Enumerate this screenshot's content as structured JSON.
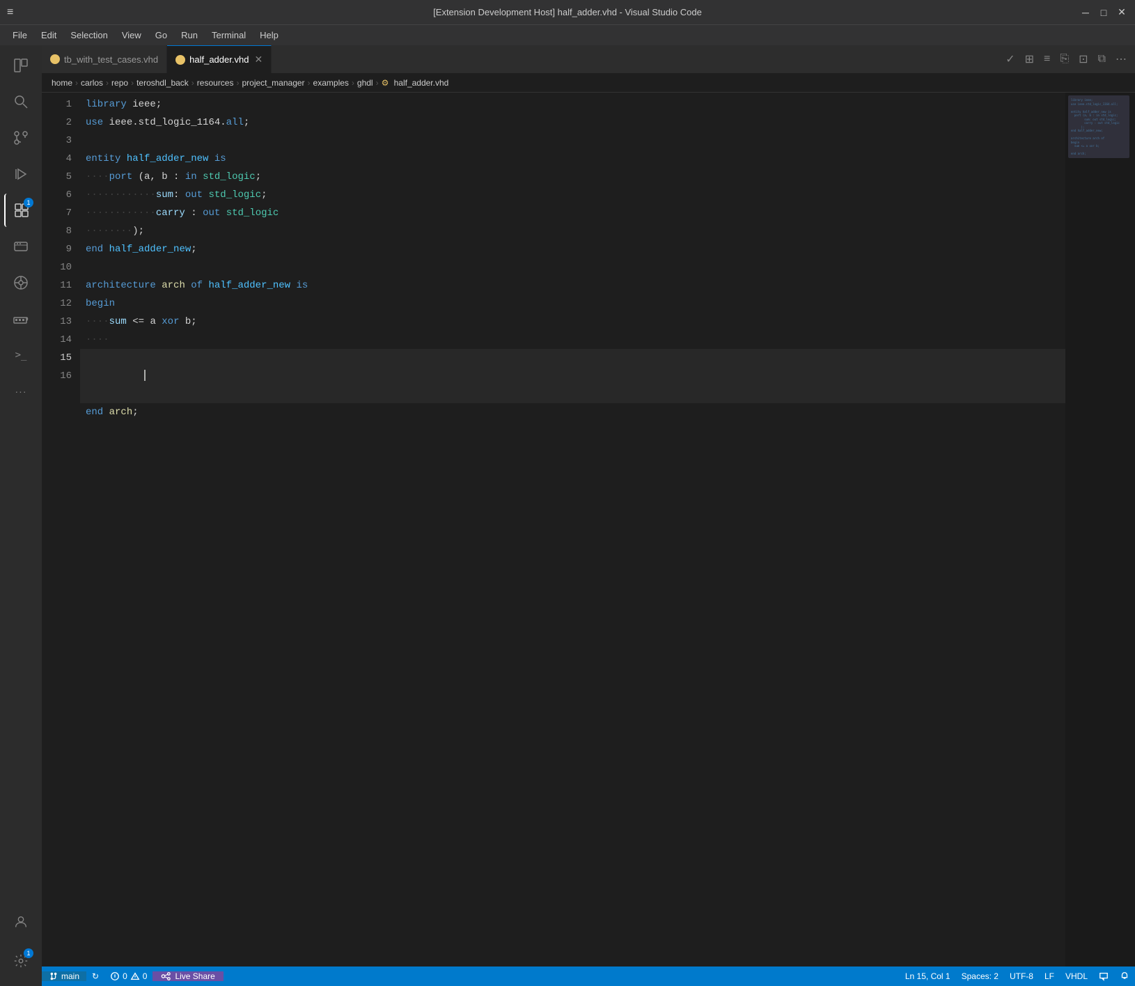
{
  "titleBar": {
    "title": "[Extension Development Host] half_adder.vhd - Visual Studio Code",
    "hamburgerIcon": "≡",
    "minimizeIcon": "─",
    "maximizeIcon": "□",
    "closeIcon": "✕"
  },
  "menuBar": {
    "items": [
      "File",
      "Edit",
      "Selection",
      "View",
      "Go",
      "Run",
      "Terminal",
      "Help"
    ]
  },
  "activityBar": {
    "icons": [
      {
        "name": "explorer-icon",
        "symbol": "⧉",
        "active": false
      },
      {
        "name": "search-icon",
        "symbol": "🔍",
        "active": false
      },
      {
        "name": "source-control-icon",
        "symbol": "⑂",
        "active": false
      },
      {
        "name": "run-debug-icon",
        "symbol": "▷",
        "active": false
      },
      {
        "name": "extensions-icon",
        "symbol": "⊞",
        "active": true,
        "badge": "1"
      },
      {
        "name": "remote-explorer-icon",
        "symbol": "🖥",
        "active": false
      },
      {
        "name": "teroshdl-icon",
        "symbol": "⚙",
        "active": false
      },
      {
        "name": "docker-icon",
        "symbol": "🐋",
        "active": false
      },
      {
        "name": "terminal-icon",
        "symbol": ">_",
        "active": false
      },
      {
        "name": "more-icon",
        "symbol": "...",
        "active": false
      }
    ],
    "bottomIcons": [
      {
        "name": "account-icon",
        "symbol": "👤"
      },
      {
        "name": "settings-icon",
        "symbol": "⚙",
        "badge": "1"
      }
    ]
  },
  "tabs": {
    "items": [
      {
        "label": "tb_with_test_cases.vhd",
        "active": false,
        "hasClose": false
      },
      {
        "label": "half_adder.vhd",
        "active": true,
        "hasClose": true
      }
    ],
    "actionButtons": [
      "✓",
      "⊞",
      "≡",
      "⎘",
      "⊡",
      "⧉",
      "⋯"
    ]
  },
  "breadcrumb": {
    "parts": [
      "home",
      "carlos",
      "repo",
      "teroshdl_back",
      "resources",
      "project_manager",
      "examples",
      "ghdl",
      "half_adder.vhd"
    ]
  },
  "codeLines": [
    {
      "num": 1,
      "text": "library ieee;"
    },
    {
      "num": 2,
      "text": "use ieee.std_logic_1164.all;"
    },
    {
      "num": 3,
      "text": ""
    },
    {
      "num": 4,
      "text": "entity half_adder_new is"
    },
    {
      "num": 5,
      "text": "    port (a, b : in std_logic;"
    },
    {
      "num": 6,
      "text": "            sum: out std_logic;"
    },
    {
      "num": 7,
      "text": "            carry : out std_logic"
    },
    {
      "num": 8,
      "text": "        );"
    },
    {
      "num": 9,
      "text": "end half_adder_new;"
    },
    {
      "num": 10,
      "text": ""
    },
    {
      "num": 11,
      "text": "architecture arch of half_adder_new is"
    },
    {
      "num": 12,
      "text": "begin"
    },
    {
      "num": 13,
      "text": "    sum <= a xor b;"
    },
    {
      "num": 14,
      "text": "    "
    },
    {
      "num": 15,
      "text": ""
    },
    {
      "num": 16,
      "text": "end arch;"
    }
  ],
  "statusBar": {
    "gitBranch": "main",
    "syncIcon": "↻",
    "errors": "0",
    "warnings": "0",
    "liveShare": "Live Share",
    "position": "Ln 15, Col 1",
    "spaces": "Spaces: 2",
    "encoding": "UTF-8",
    "lineEnding": "LF",
    "language": "VHDL",
    "feedbackIcon": "💬",
    "bellIcon": "🔔"
  }
}
